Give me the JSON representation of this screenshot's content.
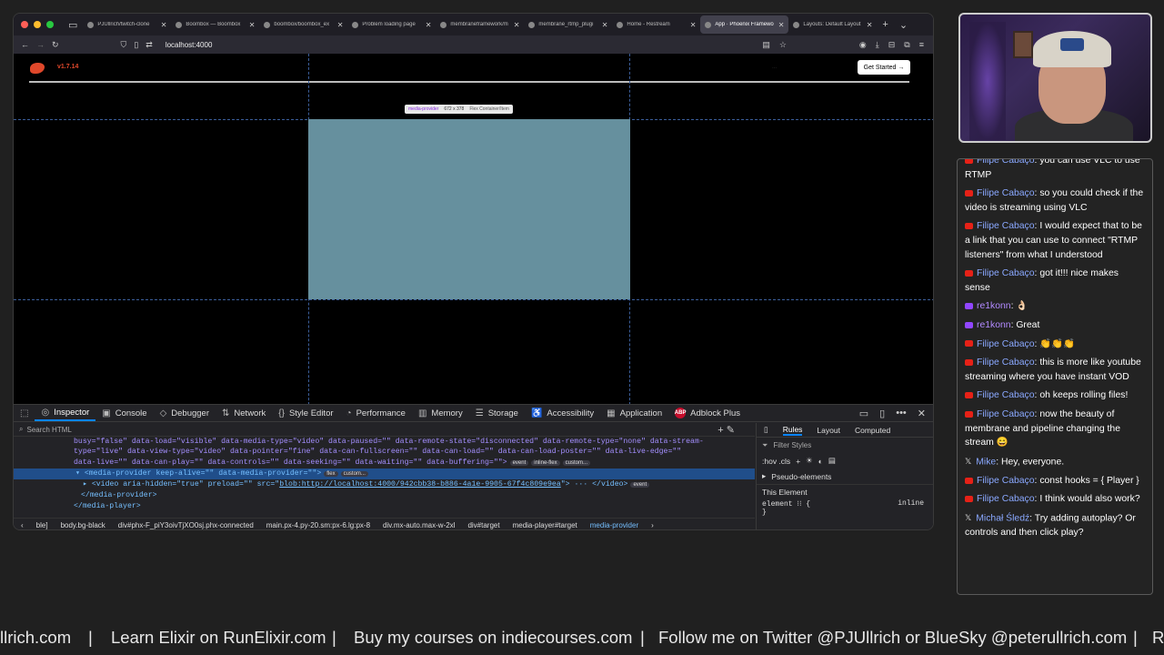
{
  "browser": {
    "tabs": [
      {
        "label": "PJUllrich/twitch-clone",
        "active": false
      },
      {
        "label": "Boombox — Boombox",
        "active": false
      },
      {
        "label": "boombox/boombox_ex",
        "active": false
      },
      {
        "label": "Problem loading page",
        "active": false
      },
      {
        "label": "membraneframework/m",
        "active": false
      },
      {
        "label": "membrane_rtmp_plugi",
        "active": false
      },
      {
        "label": "Home - Restream",
        "active": false
      },
      {
        "label": "App · Phoenix Framewo",
        "active": true
      },
      {
        "label": "Layouts: Default Layout",
        "active": false
      }
    ],
    "url": "localhost:4000"
  },
  "page": {
    "version": "v1.7.14",
    "faint_nav": "...",
    "get_started": "Get Started →",
    "tooltip_name": "media-provider",
    "tooltip_size": "672 x 378",
    "tooltip_type": "Flex Container/Item"
  },
  "devtools": {
    "tabs": [
      "Inspector",
      "Console",
      "Debugger",
      "Network",
      "Style Editor",
      "Performance",
      "Memory",
      "Storage",
      "Accessibility",
      "Application",
      "Adblock Plus"
    ],
    "search_placeholder": "Search HTML",
    "code_line1": "busy=\"false\" data-load=\"visible\" data-media-type=\"video\" data-paused=\"\" data-remote-state=\"disconnected\" data-remote-type=\"none\" data-stream-",
    "code_line2": "type=\"live\" data-view-type=\"video\" data-pointer=\"fine\" data-can-fullscreen=\"\" data-can-load=\"\" data-can-load-poster=\"\" data-live-edge=\"\"",
    "code_line3": "data-live=\"\" data-can-play=\"\" data-controls=\"\" data-seeking=\"\" data-waiting=\"\" data-buffering=\"\">",
    "pills_line3": [
      "event",
      "inline-flex",
      "custom..."
    ],
    "code_line4": "▾ <media-provider keep-alive=\"\" data-media-provider=\"\">",
    "pills_line4": [
      "flex",
      "custom..."
    ],
    "code_line5a": "▸ <video aria-hidden=\"true\" preload=\"\" src=\"",
    "code_line5_link": "blob:http://localhost:4000/942cbb38-b886-4a1e-9905-67f4c809e9ea",
    "code_line5b": "\"> ··· </video>",
    "pill_line5": "event",
    "code_line6": "</media-provider>",
    "code_line7": "</media-player>",
    "breadcrumbs": [
      "ble]",
      "body.bg-black",
      "div#phx-F_piY3oivTjXO0sj.phx-connected",
      "main.px-4.py-20.sm:px-6.lg:px-8",
      "div.mx-auto.max-w-2xl",
      "div#target",
      "media-player#target",
      "media-provider"
    ],
    "rules_tabs": [
      "Rules",
      "Layout",
      "Computed"
    ],
    "filter_styles": "Filter Styles",
    "hov_cls": ":hov .cls",
    "pseudo_elements": "Pseudo-elements",
    "this_element": "This Element",
    "element_rule": "element ⁝⁝ {",
    "element_display": "inline",
    "close_brace": "}"
  },
  "chat": [
    {
      "platform": "youtube",
      "user": "Filipe Cabaço",
      "text": "you can use VLC to use RTMP"
    },
    {
      "platform": "youtube",
      "user": "Filipe Cabaço",
      "text": "so you could check if the video is streaming using VLC"
    },
    {
      "platform": "youtube",
      "user": "Filipe Cabaço",
      "text": "I would expect that to be a link that you can use to connect \"RTMP listeners\" from what I understood"
    },
    {
      "platform": "youtube",
      "user": "Filipe Cabaço",
      "text": "got it!!! nice makes sense"
    },
    {
      "platform": "twitch",
      "user": "re1konn",
      "text": "👌🏻"
    },
    {
      "platform": "twitch",
      "user": "re1konn",
      "text": "Great"
    },
    {
      "platform": "youtube",
      "user": "Filipe Cabaço",
      "text": "👏👏👏"
    },
    {
      "platform": "youtube",
      "user": "Filipe Cabaço",
      "text": "this is more like youtube streaming where you have instant VOD"
    },
    {
      "platform": "youtube",
      "user": "Filipe Cabaço",
      "text": "oh keeps rolling files!"
    },
    {
      "platform": "youtube",
      "user": "Filipe Cabaço",
      "text": "now the beauty of membrane and pipeline changing the stream 😄"
    },
    {
      "platform": "x",
      "user": "Mike",
      "text": "Hey, everyone."
    },
    {
      "platform": "youtube",
      "user": "Filipe Cabaço",
      "text": "const hooks = { Player }"
    },
    {
      "platform": "youtube",
      "user": "Filipe Cabaço",
      "text": "I think would also work?"
    },
    {
      "platform": "x",
      "user": "Michał Śledź",
      "text": "Try adding autoplay? Or controls and then click play?"
    }
  ],
  "ticker": [
    "llrich.com",
    "|",
    "Learn Elixir on RunElixir.com",
    "|",
    "Buy my courses on indiecourses.com",
    "|",
    "Follow me on Twitter @PJUllrich or BlueSky @peterullrich.com",
    "|",
    "R"
  ],
  "colors": {
    "accent": "#0a84ff",
    "phoenix": "#e0482b",
    "provider_highlight": "#66909e",
    "youtube": "#e62117",
    "twitch": "#9146ff"
  }
}
